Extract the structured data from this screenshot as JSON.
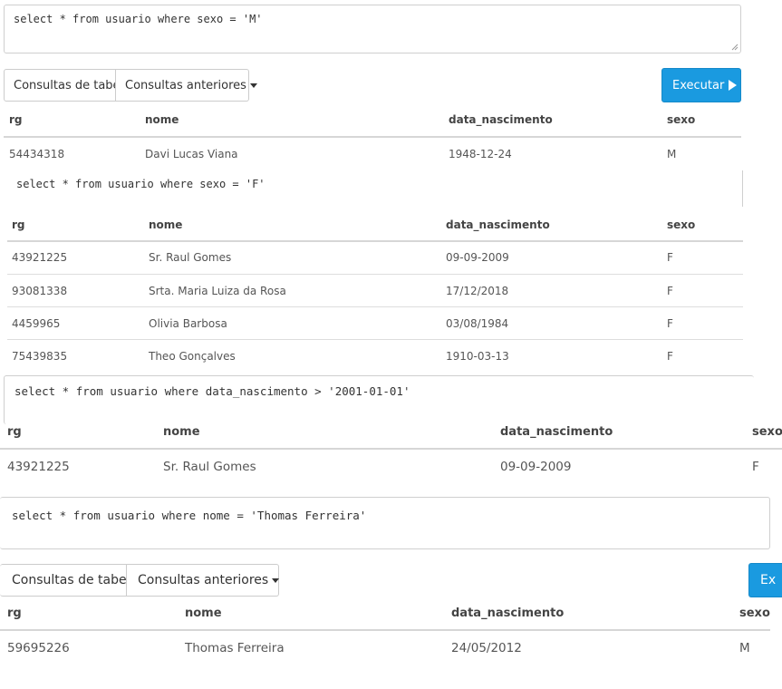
{
  "query1": {
    "text": "select * from usuario where sexo = 'M'"
  },
  "toolbar1": {
    "tables_label": "Consultas de tabela",
    "previous_label": "Consultas anteriores",
    "execute_label": "Executar"
  },
  "result1": {
    "columns": [
      "rg",
      "nome",
      "data_nascimento",
      "sexo"
    ],
    "rows": [
      [
        "54434318",
        "Davi Lucas Viana",
        "1948-12-24",
        "M"
      ]
    ]
  },
  "query2": {
    "text": "select * from usuario where sexo = 'F'"
  },
  "result2": {
    "columns": [
      "rg",
      "nome",
      "data_nascimento",
      "sexo"
    ],
    "rows": [
      [
        "43921225",
        "Sr. Raul Gomes",
        "09-09-2009",
        "F"
      ],
      [
        "93081338",
        "Srta. Maria Luiza da Rosa",
        "17/12/2018",
        "F"
      ],
      [
        "4459965",
        "Olivia Barbosa",
        "03/08/1984",
        "F"
      ],
      [
        "75439835",
        "Theo Gonçalves",
        "1910-03-13",
        "F"
      ]
    ]
  },
  "query3": {
    "text": "select * from usuario where data_nascimento > '2001-01-01'"
  },
  "result3": {
    "columns": [
      "rg",
      "nome",
      "data_nascimento",
      "sexo"
    ],
    "rows": [
      [
        "43921225",
        "Sr. Raul Gomes",
        "09-09-2009",
        "F"
      ]
    ]
  },
  "query4": {
    "text": "select * from usuario where nome = 'Thomas Ferreira'"
  },
  "toolbar4": {
    "tables_label": "Consultas de tabela",
    "previous_label": "Consultas anteriores",
    "execute_label": "Ex"
  },
  "result4": {
    "columns": [
      "rg",
      "nome",
      "data_nascimento",
      "sexo"
    ],
    "rows": [
      [
        "59695226",
        "Thomas Ferreira",
        "24/05/2012",
        "M"
      ]
    ]
  }
}
